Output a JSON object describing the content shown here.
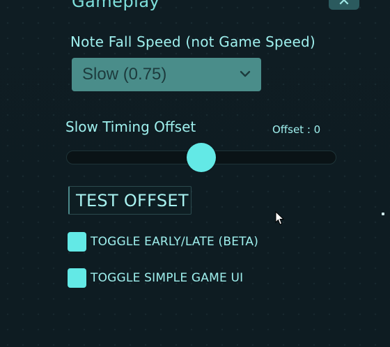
{
  "section": {
    "title": "Gameplay",
    "close_icon": "close-icon"
  },
  "note_fall": {
    "label": "Note Fall Speed (not Game Speed)",
    "selected": "Slow (0.75)",
    "chevron_icon": "chevron-down-icon"
  },
  "timing": {
    "label": "Slow Timing Offset",
    "readout": "Offset : 0",
    "slider_fraction": 0.5
  },
  "test_button": {
    "label": "TEST OFFSET"
  },
  "toggles": [
    {
      "label": "TOGGLE EARLY/LATE (BETA)"
    },
    {
      "label": "TOGGLE SIMPLE GAME UI"
    }
  ],
  "colors": {
    "accent": "#63e9e6",
    "dropdown_bg": "#4a8d8a",
    "background": "#0f1d23",
    "text": "#9ff0ee"
  }
}
